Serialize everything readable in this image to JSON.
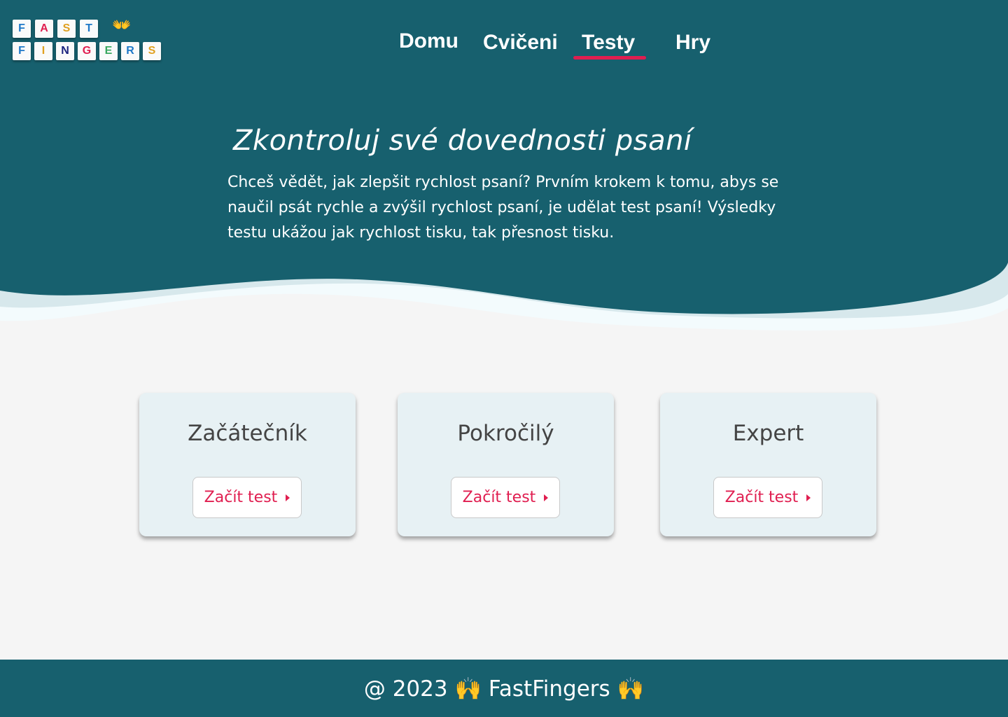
{
  "logo": {
    "row1": [
      {
        "letter": "F",
        "color": "#1e78c8"
      },
      {
        "letter": "A",
        "color": "#e01e50"
      },
      {
        "letter": "S",
        "color": "#e0a020"
      },
      {
        "letter": "T",
        "color": "#1e78c8"
      }
    ],
    "row2": [
      {
        "letter": "F",
        "color": "#1e78c8"
      },
      {
        "letter": "I",
        "color": "#e0a020"
      },
      {
        "letter": "N",
        "color": "#1a237e"
      },
      {
        "letter": "G",
        "color": "#e01e50"
      },
      {
        "letter": "E",
        "color": "#3aa860"
      },
      {
        "letter": "R",
        "color": "#1e78c8"
      },
      {
        "letter": "S",
        "color": "#e0a020"
      }
    ],
    "emoji": "👐"
  },
  "nav": {
    "items": [
      "Domu",
      "Cvičeni",
      "Testy",
      "Hry"
    ],
    "active": "Testy",
    "underline_color": "#e01e50"
  },
  "hero": {
    "title": "Zkontroluj své dovednosti psaní",
    "text": "Chceš vědět, jak zlepšit rychlost psaní? Prvním krokem k tomu, abys se naučil psát rychle a zvýšil rychlost psaní, je udělat test psaní! Výsledky testu ukážou jak rychlost tisku, tak přesnost tisku.",
    "bg_color": "#17606e"
  },
  "cards": [
    {
      "title": "Začátečník",
      "button": "Začít test"
    },
    {
      "title": "Pokročilý",
      "button": "Začít test"
    },
    {
      "title": "Expert",
      "button": "Začít test"
    }
  ],
  "footer": {
    "text": "@ 2023 🙌 FastFingers 🙌"
  }
}
